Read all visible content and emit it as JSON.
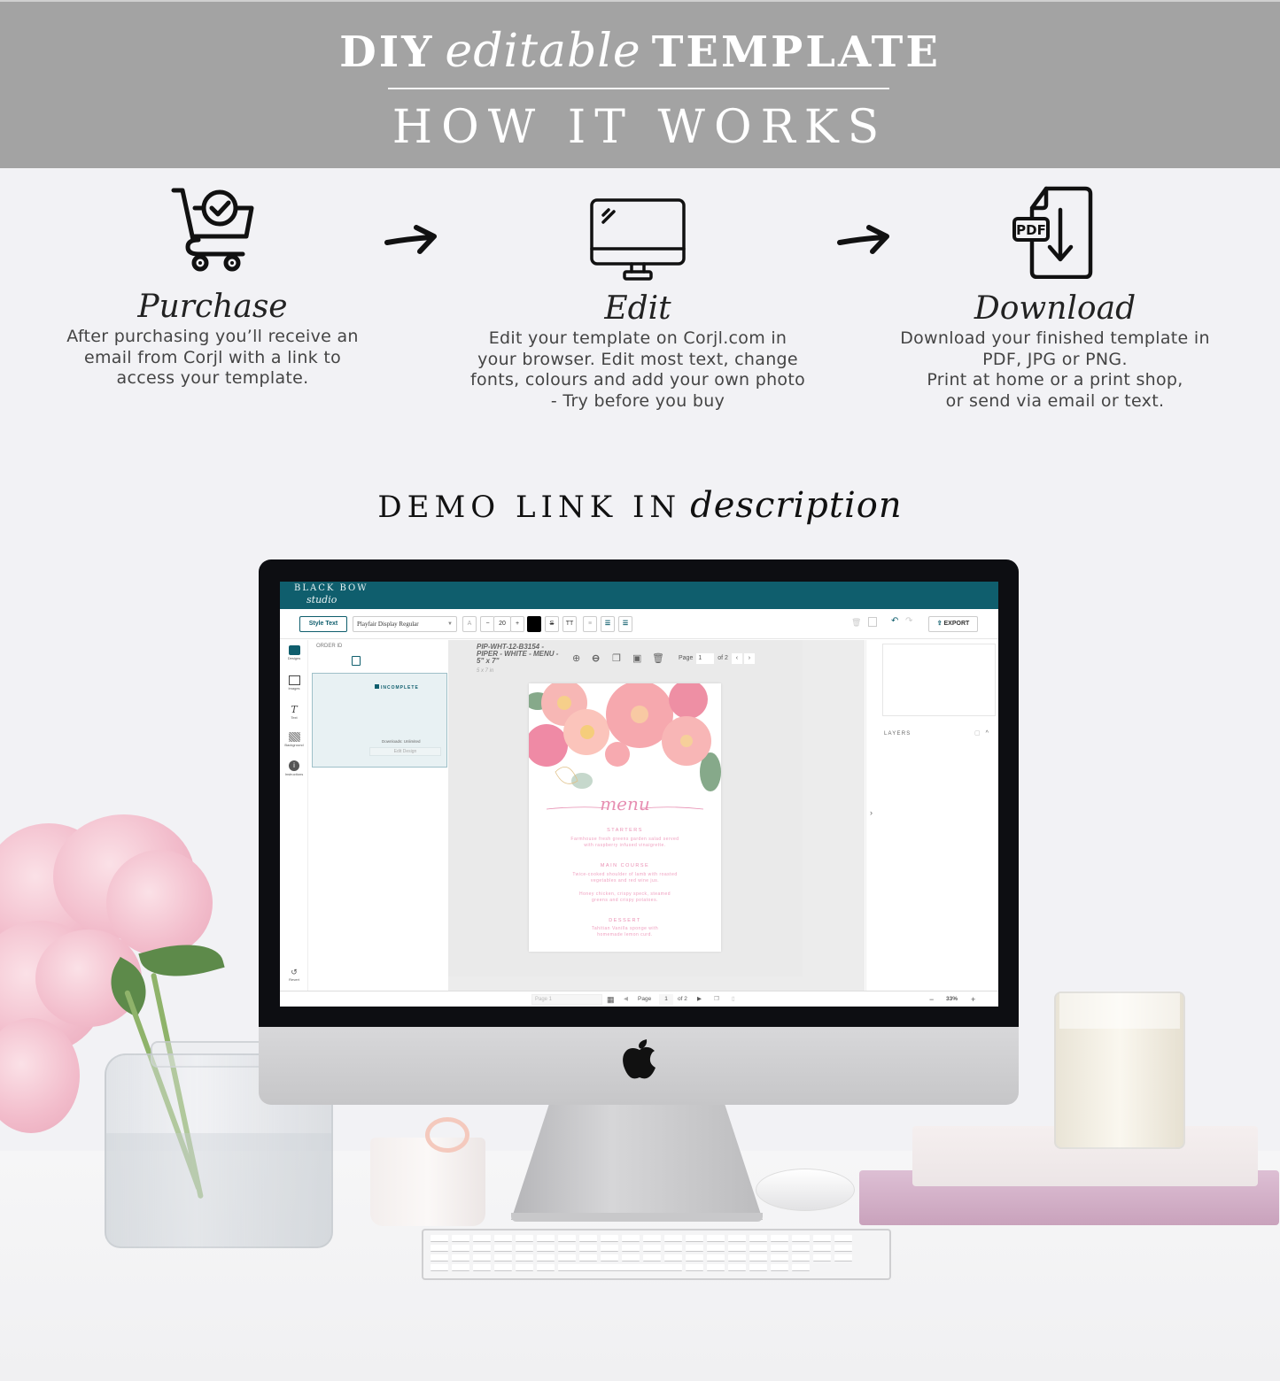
{
  "banner": {
    "line1_left": "DIY",
    "line1_script": "editable",
    "line1_right": "TEMPLATE",
    "line2": "HOW IT WORKS"
  },
  "steps": [
    {
      "icon": "shopping-cart-check-icon",
      "title": "Purchase",
      "desc_lines": [
        "After purchasing you’ll receive an",
        "email from Corjl with a link to",
        "access your template."
      ]
    },
    {
      "icon": "desktop-monitor-icon",
      "title": "Edit",
      "desc_lines": [
        "Edit your template on Corjl.com in",
        "your browser. Edit most text, change",
        "fonts, colours and add your own photo",
        "- Try before you buy"
      ]
    },
    {
      "icon": "pdf-download-icon",
      "title": "Download",
      "desc_lines": [
        "Download your finished template in",
        "PDF, JPG or PNG.",
        "Print at home or a print shop,",
        "or send via email or text."
      ],
      "pdf_badge": "PDF"
    }
  ],
  "demo": {
    "prefix": "DEMO LINK IN",
    "script": "description"
  },
  "app": {
    "brand": "BLACK BOW",
    "brand_sub": "studio",
    "toolbar": {
      "style_text": "Style Text",
      "font": "Playfair Display Regular",
      "font_size": "20",
      "minus": "−",
      "plus": "+",
      "text_color": "#000000",
      "export": "EXPORT"
    },
    "rail": [
      {
        "label": "Designs",
        "icon": "designs-icon"
      },
      {
        "label": "Images",
        "icon": "image-icon"
      },
      {
        "label": "Text",
        "icon": "text-icon"
      },
      {
        "label": "Background",
        "icon": "background-icon"
      },
      {
        "label": "Instructions",
        "icon": "info-icon"
      }
    ],
    "revert": "Revert",
    "panel": {
      "order_id": "ORDER ID",
      "status": "INCOMPLETE",
      "downloads": "Downloads: Unlimited",
      "edit_design": "Edit Design"
    },
    "document": {
      "title": "PIP-WHT-12-B3154 - PIPER - WHITE - MENU - 5\" x 7\"",
      "size": "5 x 7 in",
      "page_label": "Page",
      "page_value": "1",
      "page_of": "of 2"
    },
    "menu_card": {
      "script_title": "menu",
      "sections": [
        {
          "heading": "STARTERS",
          "items": [
            "Farmhouse fresh greens garden salad served",
            "with raspberry infused vinaigrette."
          ]
        },
        {
          "heading": "MAIN COURSE",
          "items": [
            "Twice-cooked shoulder of lamb with roasted",
            "vegetables and red wine jus.",
            "Honey chicken, crispy speck, steamed",
            "greens and crispy potatoes."
          ]
        },
        {
          "heading": "DESSERT",
          "items": [
            "Tahitian Vanilla sponge with",
            "homemade lemon curd."
          ]
        }
      ]
    },
    "right_panel": {
      "layers": "LAYERS"
    },
    "bottom": {
      "page_placeholder": "Page 1",
      "page_label": "Page",
      "page_value": "1",
      "page_of": "of 2",
      "zoom": "33%",
      "zoom_minus": "−",
      "zoom_plus": "+"
    },
    "colors": {
      "brand_teal": "#0f5e6d",
      "menu_pink": "#e78fb2"
    }
  }
}
